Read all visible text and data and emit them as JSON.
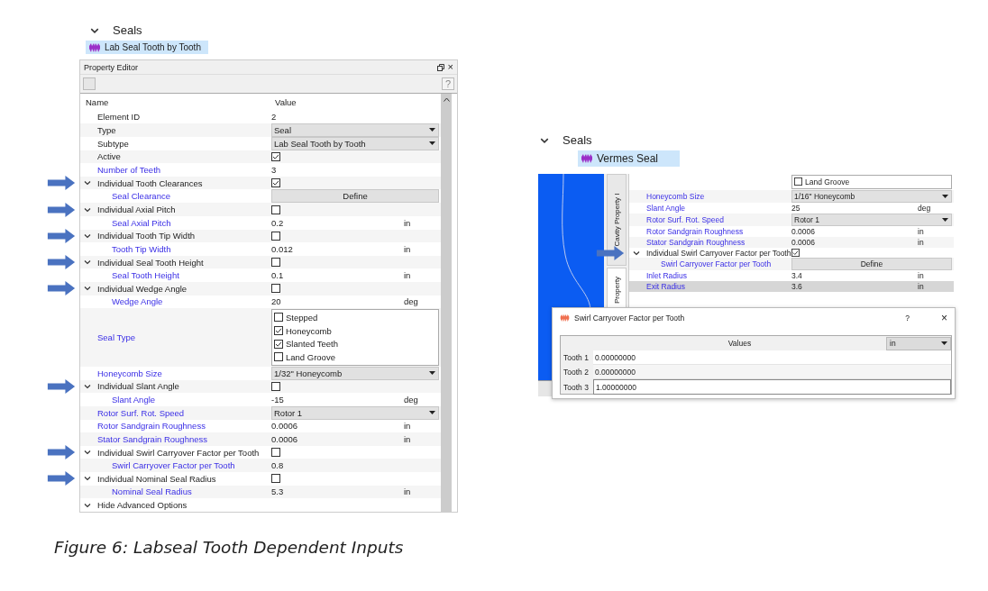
{
  "left": {
    "tree": {
      "group": "Seals",
      "item": "Lab Seal Tooth by Tooth"
    },
    "editor": {
      "title": "Property Editor",
      "close": "×",
      "help": "?",
      "columns": [
        "Name",
        "Value"
      ],
      "rows": [
        {
          "label": "Element ID",
          "kind": "text",
          "link": false,
          "value": "2"
        },
        {
          "label": "Type",
          "kind": "dropdown",
          "link": false,
          "value": "Seal"
        },
        {
          "label": "Subtype",
          "kind": "dropdown",
          "link": false,
          "value": "Lab Seal Tooth by Tooth"
        },
        {
          "label": "Active",
          "kind": "checkbox",
          "link": false,
          "checked": true
        },
        {
          "label": "Number of Teeth",
          "kind": "text",
          "link": true,
          "value": "3"
        },
        {
          "label": "Individual Tooth Clearances",
          "kind": "checkbox",
          "link": false,
          "marked": true,
          "checked": true,
          "expanded": true,
          "children": [
            {
              "label": "Seal Clearance",
              "kind": "button",
              "link": true,
              "value": "Define"
            }
          ]
        },
        {
          "label": "Individual Axial Pitch",
          "kind": "checkbox",
          "link": false,
          "marked": true,
          "checked": false,
          "expanded": true,
          "children": [
            {
              "label": "Seal Axial Pitch",
              "kind": "text",
              "link": true,
              "value": "0.2",
              "unit": "in"
            }
          ]
        },
        {
          "label": "Individual Tooth Tip Width",
          "kind": "checkbox",
          "link": false,
          "marked": true,
          "checked": false,
          "expanded": true,
          "children": [
            {
              "label": "Tooth Tip Width",
              "kind": "text",
              "link": true,
              "value": "0.012",
              "unit": "in"
            }
          ]
        },
        {
          "label": "Individual Seal Tooth Height",
          "kind": "checkbox",
          "link": false,
          "marked": true,
          "checked": false,
          "expanded": true,
          "children": [
            {
              "label": "Seal Tooth Height",
              "kind": "text",
              "link": true,
              "value": "0.1",
              "unit": "in"
            }
          ]
        },
        {
          "label": "Individual Wedge Angle",
          "kind": "checkbox",
          "link": false,
          "marked": true,
          "checked": false,
          "expanded": true,
          "children": [
            {
              "label": "Wedge Angle",
              "kind": "text",
              "link": true,
              "value": "20",
              "unit": "deg"
            }
          ]
        },
        {
          "label": "Seal Type",
          "kind": "checklist",
          "link": true,
          "options": [
            {
              "label": "Stepped",
              "checked": false
            },
            {
              "label": "Honeycomb",
              "checked": true
            },
            {
              "label": "Slanted Teeth",
              "checked": true
            },
            {
              "label": "Land Groove",
              "checked": false
            }
          ]
        },
        {
          "label": "Honeycomb Size",
          "kind": "dropdown",
          "link": true,
          "value": "1/32\" Honeycomb"
        },
        {
          "label": "Individual Slant Angle",
          "kind": "checkbox",
          "link": false,
          "marked": true,
          "checked": false,
          "expanded": true,
          "children": [
            {
              "label": "Slant Angle",
              "kind": "text",
              "link": true,
              "value": "-15",
              "unit": "deg"
            }
          ]
        },
        {
          "label": "Rotor Surf. Rot. Speed",
          "kind": "dropdown",
          "link": true,
          "value": "Rotor 1"
        },
        {
          "label": "Rotor Sandgrain Roughness",
          "kind": "text",
          "link": true,
          "value": "0.0006",
          "unit": "in"
        },
        {
          "label": "Stator Sandgrain Roughness",
          "kind": "text",
          "link": true,
          "value": "0.0006",
          "unit": "in"
        },
        {
          "label": "Individual Swirl Carryover Factor per Tooth",
          "kind": "checkbox",
          "link": false,
          "marked": true,
          "checked": false,
          "expanded": true,
          "children": [
            {
              "label": "Swirl Carryover Factor per Tooth",
              "kind": "text",
              "link": true,
              "value": "0.8"
            }
          ]
        },
        {
          "label": "Individual Nominal Seal Radius",
          "kind": "checkbox",
          "link": false,
          "marked": true,
          "checked": false,
          "expanded": true,
          "children": [
            {
              "label": "Nominal Seal Radius",
              "kind": "text",
              "link": true,
              "value": "5.3",
              "unit": "in"
            }
          ]
        },
        {
          "label": "Hide Advanced Options",
          "kind": "none",
          "link": false,
          "expanded": true
        }
      ]
    }
  },
  "right": {
    "tree": {
      "group": "Seals",
      "item": "Vermes Seal"
    },
    "side_tabs": [
      "Cavity Property I",
      "Property"
    ],
    "editor": {
      "rows": [
        {
          "kind": "checklist",
          "selected": false,
          "options": [
            {
              "label": "Land Groove",
              "checked": false
            }
          ]
        },
        {
          "label": "Honeycomb Size",
          "kind": "dropdown",
          "link": true,
          "selected": false,
          "value": "1/16\" Honeycomb"
        },
        {
          "label": "Slant Angle",
          "kind": "text",
          "link": true,
          "selected": false,
          "value": "25",
          "unit": "deg"
        },
        {
          "label": "Rotor Surf. Rot. Speed",
          "kind": "dropdown",
          "link": true,
          "selected": false,
          "value": "Rotor 1"
        },
        {
          "label": "Rotor Sandgrain Roughness",
          "kind": "text",
          "link": true,
          "selected": false,
          "value": "0.0006",
          "unit": "in"
        },
        {
          "label": "Stator Sandgrain Roughness",
          "kind": "text",
          "link": true,
          "selected": false,
          "value": "0.0006",
          "unit": "in"
        },
        {
          "label": "Individual Swirl Carryover Factor per Tooth",
          "kind": "checkbox",
          "link": false,
          "marked": true,
          "selected": false,
          "checked": true,
          "expanded": true,
          "children": [
            {
              "label": "Swirl Carryover Factor per Tooth",
              "kind": "button",
              "link": true,
              "selected": false,
              "value": "Define"
            }
          ]
        },
        {
          "label": "Inlet Radius",
          "kind": "text",
          "link": true,
          "selected": false,
          "value": "3.4",
          "unit": "in"
        },
        {
          "label": "Exit Radius",
          "kind": "text",
          "link": true,
          "selected": true,
          "value": "3.6",
          "unit": "in"
        }
      ]
    },
    "dialog": {
      "title": "Swirl Carryover Factor per Tooth",
      "help": "?",
      "close": "×",
      "column": "Values",
      "unit": "in",
      "rows": [
        {
          "label": "Tooth 1",
          "value": "0.00000000",
          "selected": false
        },
        {
          "label": "Tooth 2",
          "value": "0.00000000",
          "selected": false
        },
        {
          "label": "Tooth 3",
          "value": "1.00000000",
          "selected": true
        }
      ]
    }
  },
  "caption": "Figure 6: Labseal Tooth Dependent Inputs"
}
